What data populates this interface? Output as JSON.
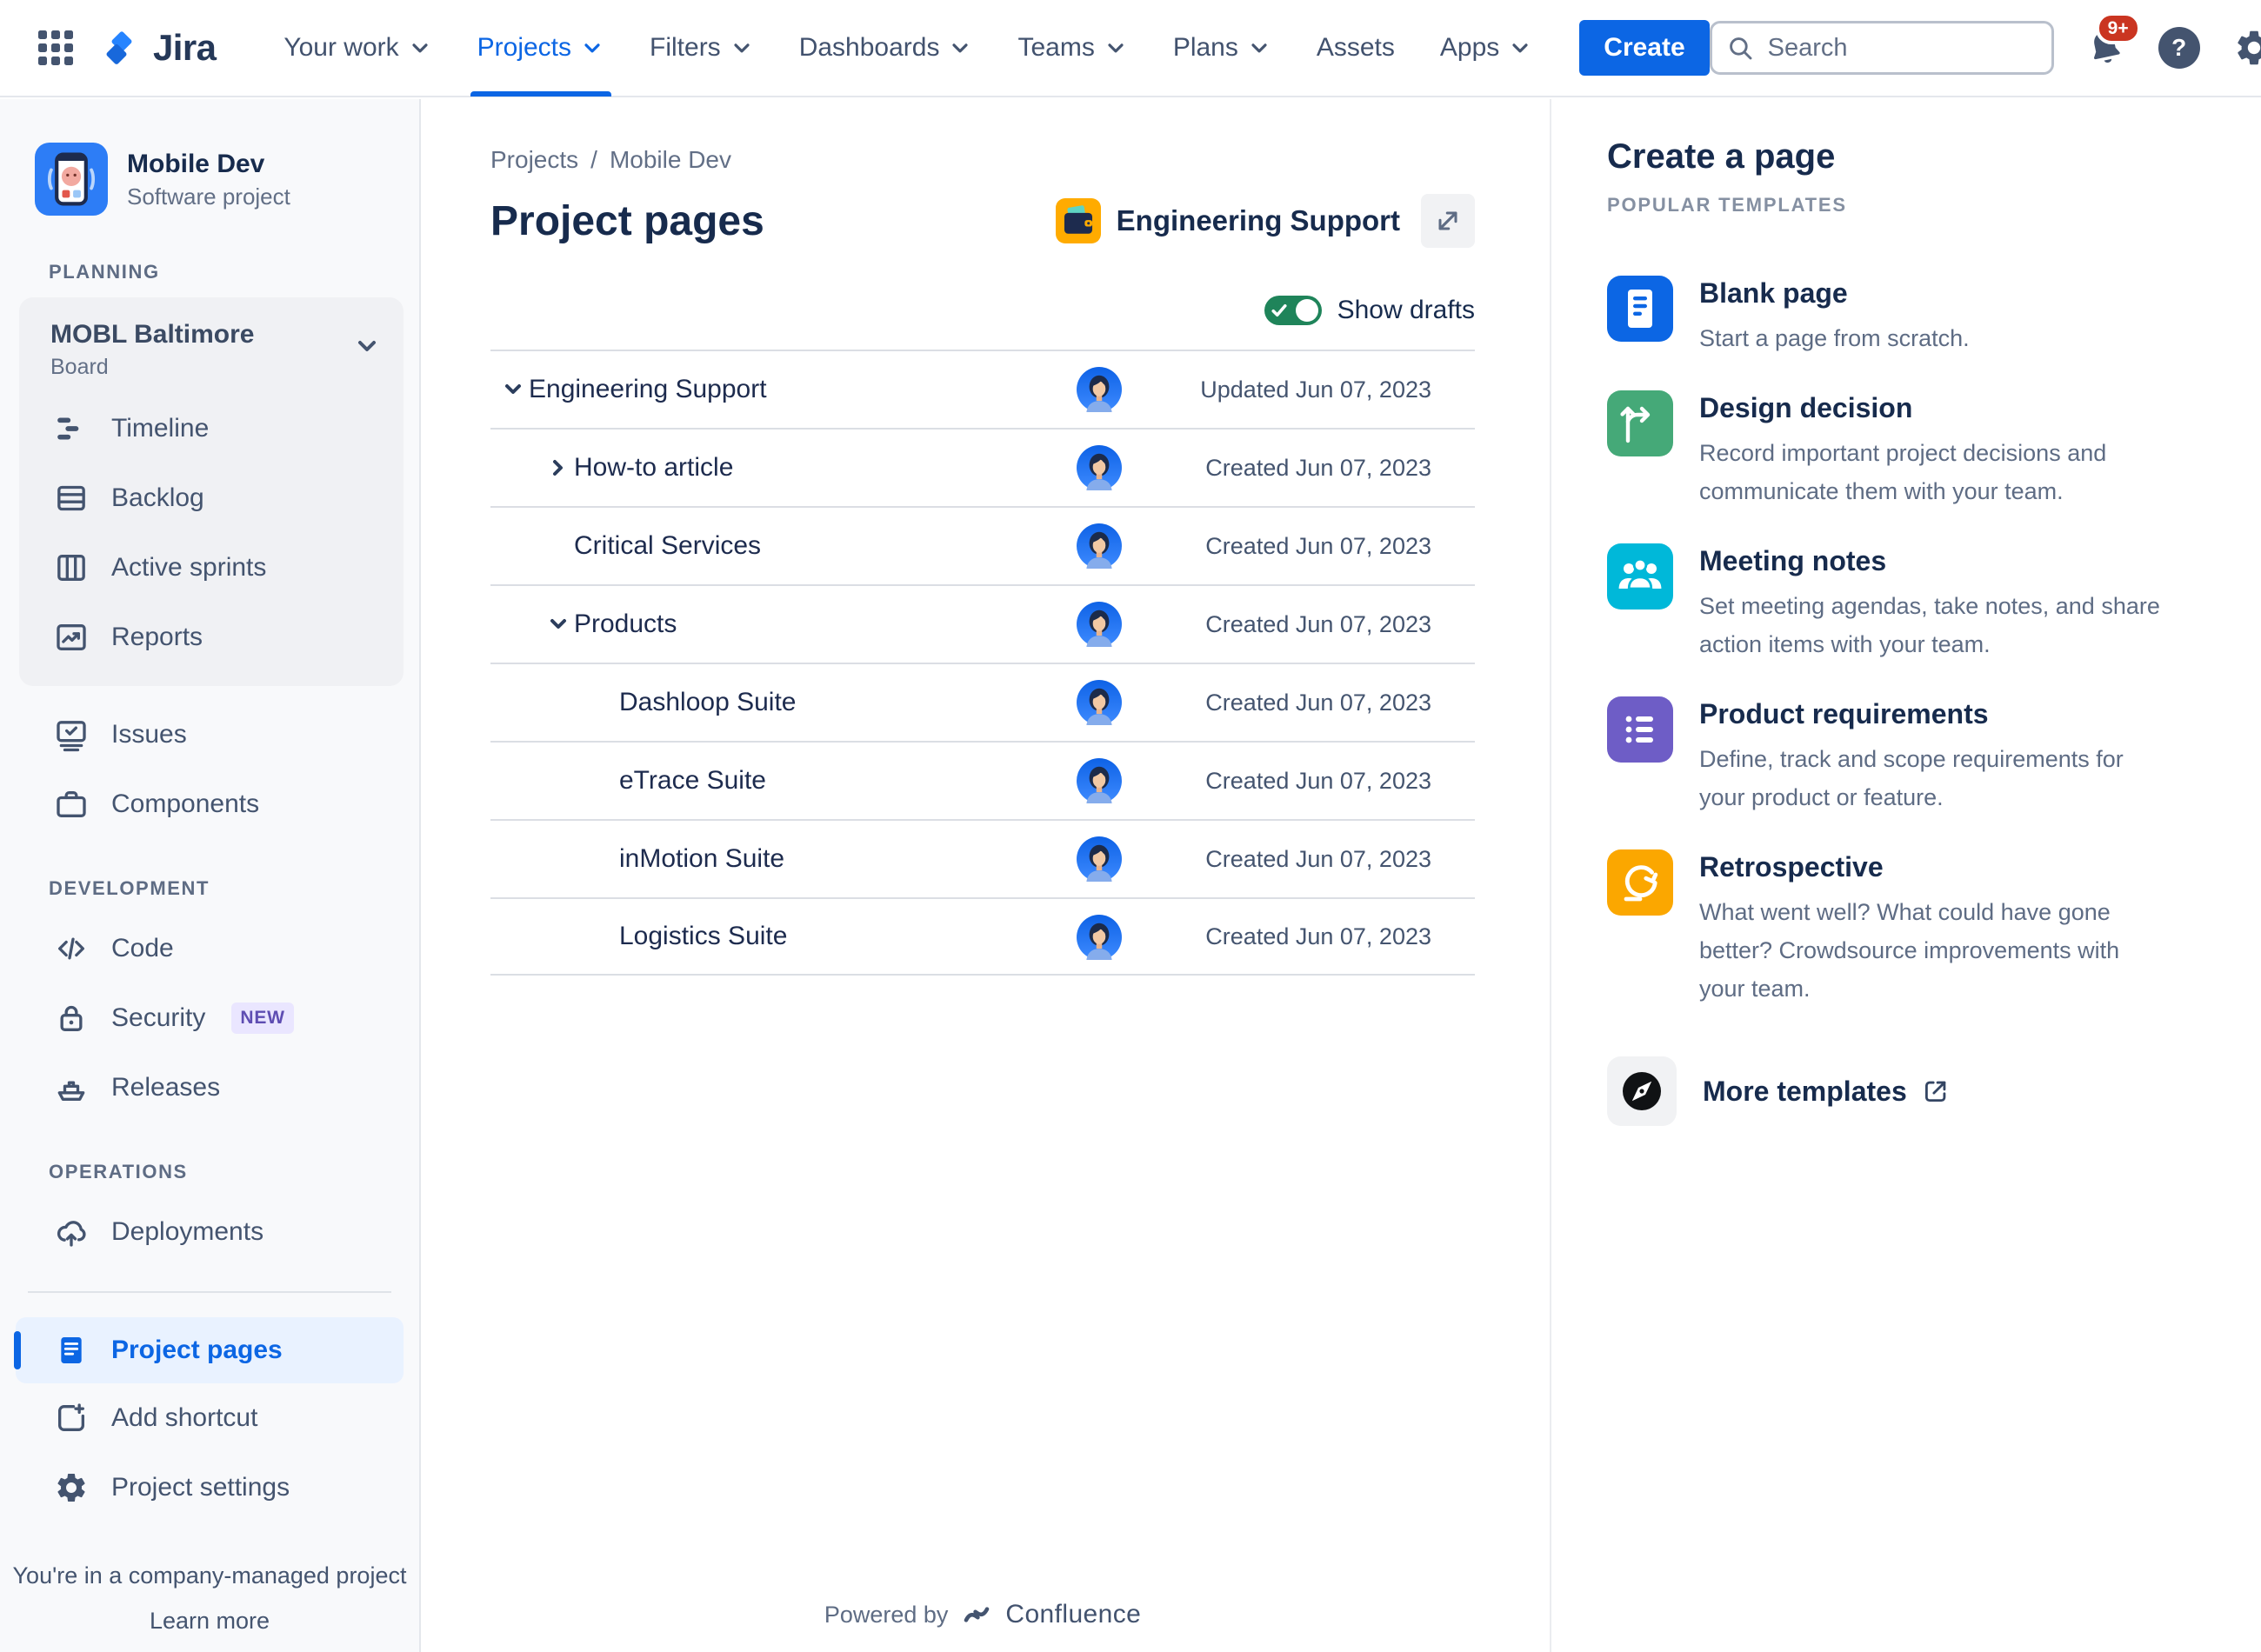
{
  "app": {
    "name": "Jira"
  },
  "nav": {
    "items": [
      {
        "label": "Your work",
        "chevron": true,
        "active": false
      },
      {
        "label": "Projects",
        "chevron": true,
        "active": true
      },
      {
        "label": "Filters",
        "chevron": true,
        "active": false
      },
      {
        "label": "Dashboards",
        "chevron": true,
        "active": false
      },
      {
        "label": "Teams",
        "chevron": true,
        "active": false
      },
      {
        "label": "Plans",
        "chevron": true,
        "active": false
      },
      {
        "label": "Assets",
        "chevron": false,
        "active": false
      },
      {
        "label": "Apps",
        "chevron": true,
        "active": false
      }
    ],
    "create_label": "Create",
    "search_placeholder": "Search",
    "notification_badge": "9+",
    "help_glyph": "?"
  },
  "sidebar": {
    "project": {
      "name": "Mobile Dev",
      "type": "Software project"
    },
    "planning_label": "PLANNING",
    "board": {
      "name": "MOBL Baltimore",
      "type": "Board",
      "items": [
        {
          "label": "Timeline"
        },
        {
          "label": "Backlog"
        },
        {
          "label": "Active sprints"
        },
        {
          "label": "Reports"
        }
      ]
    },
    "planning_items": [
      {
        "label": "Issues"
      },
      {
        "label": "Components"
      }
    ],
    "development_label": "DEVELOPMENT",
    "development_items": [
      {
        "label": "Code"
      },
      {
        "label": "Security",
        "badge": "NEW"
      },
      {
        "label": "Releases"
      }
    ],
    "operations_label": "OPERATIONS",
    "operations_items": [
      {
        "label": "Deployments"
      }
    ],
    "footer_items": [
      {
        "label": "Project pages",
        "active": true
      },
      {
        "label": "Add shortcut",
        "active": false
      },
      {
        "label": "Project settings",
        "active": false
      }
    ],
    "footer_note": "You're in a company-managed project",
    "footer_link": "Learn more"
  },
  "main": {
    "breadcrumb": [
      "Projects",
      "Mobile Dev"
    ],
    "breadcrumb_separator": "/",
    "title": "Project pages",
    "space": {
      "name": "Engineering Support"
    },
    "show_drafts_label": "Show drafts",
    "rows": [
      {
        "name": "Engineering Support",
        "level": 0,
        "chevron": "down",
        "date": "Updated Jun 07, 2023"
      },
      {
        "name": "How-to article",
        "level": 1,
        "chevron": "right",
        "date": "Created Jun 07, 2023"
      },
      {
        "name": "Critical Services",
        "level": 1,
        "chevron": null,
        "date": "Created Jun 07, 2023"
      },
      {
        "name": "Products",
        "level": 1,
        "chevron": "down",
        "date": "Created Jun 07, 2023"
      },
      {
        "name": "Dashloop Suite",
        "level": 2,
        "chevron": null,
        "date": "Created Jun 07, 2023"
      },
      {
        "name": "eTrace Suite",
        "level": 2,
        "chevron": null,
        "date": "Created Jun 07, 2023"
      },
      {
        "name": "inMotion Suite",
        "level": 2,
        "chevron": null,
        "date": "Created Jun 07, 2023"
      },
      {
        "name": "Logistics Suite",
        "level": 2,
        "chevron": null,
        "date": "Created Jun 07, 2023"
      }
    ],
    "footer": {
      "powered_by": "Powered by",
      "brand": "Confluence"
    }
  },
  "panel": {
    "title": "Create a page",
    "subtitle": "POPULAR TEMPLATES",
    "templates": [
      {
        "title": "Blank page",
        "description": "Start a page from scratch.",
        "icon": "blank-page-icon",
        "color": "#0C66E4"
      },
      {
        "title": "Design decision",
        "description": "Record important project decisions and communicate them with your team.",
        "icon": "design-decision-icon",
        "color": "#45A978"
      },
      {
        "title": "Meeting notes",
        "description": "Set meeting agendas, take notes, and share action items with your team.",
        "icon": "meeting-notes-icon",
        "color": "#00B8D9"
      },
      {
        "title": "Product requirements",
        "description": "Define, track and scope requirements for your product or feature.",
        "icon": "product-requirements-icon",
        "color": "#6E5DC6"
      },
      {
        "title": "Retrospective",
        "description": "What went well? What could have gone better? Crowdsource improvements with your team.",
        "icon": "retrospective-icon",
        "color": "#FBA700"
      }
    ],
    "more_templates_label": "More templates"
  },
  "colors": {
    "accent_blue": "#0C66E4",
    "selected_item_bg": "#E9F2FF",
    "toggle_green": "#1F845A",
    "notification_red": "#CA3521",
    "new_badge_bg": "#EAE6FF",
    "new_badge_text": "#5E4DB2",
    "space_icon_bg": "#FFAB00",
    "sidebar_bg": "#F8F9FB",
    "board_card_bg": "#F0F1F4"
  }
}
